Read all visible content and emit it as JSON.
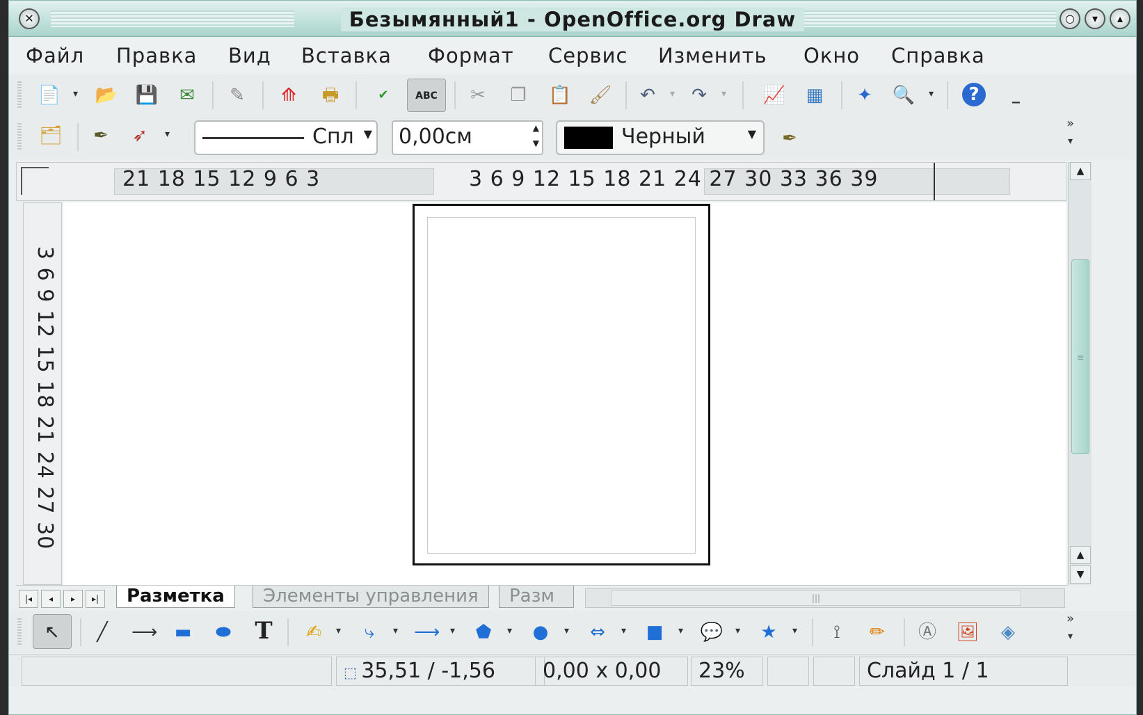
{
  "window": {
    "title": "Безымянный1 - OpenOffice.org Draw"
  },
  "menu": [
    "Файл",
    "Правка",
    "Вид",
    "Вставка",
    "Формат",
    "Сервис",
    "Изменить",
    "Окно",
    "Справка"
  ],
  "line_toolbar": {
    "line_style": "Спл",
    "line_width": "0,00см",
    "line_color_name": "Черный",
    "line_color": "#000000"
  },
  "rulers": {
    "horizontal_left": "21 18 15 12  9   6   3",
    "horizontal_right": "3   6   9  12 15 18 21 24 27 30 33 36 39",
    "vertical": "3   6   9  12 15 18 21 24 27 30"
  },
  "tabs": [
    "Разметка",
    "Элементы управления",
    "Разм"
  ],
  "statusbar": {
    "position": "35,51 / -1,56",
    "size": "0,00 x 0,00",
    "zoom": "23%",
    "slide": "Слайд 1 / 1"
  },
  "colors": {
    "titlebar": "#a9d4cc",
    "accent": "#8dbcb3"
  }
}
